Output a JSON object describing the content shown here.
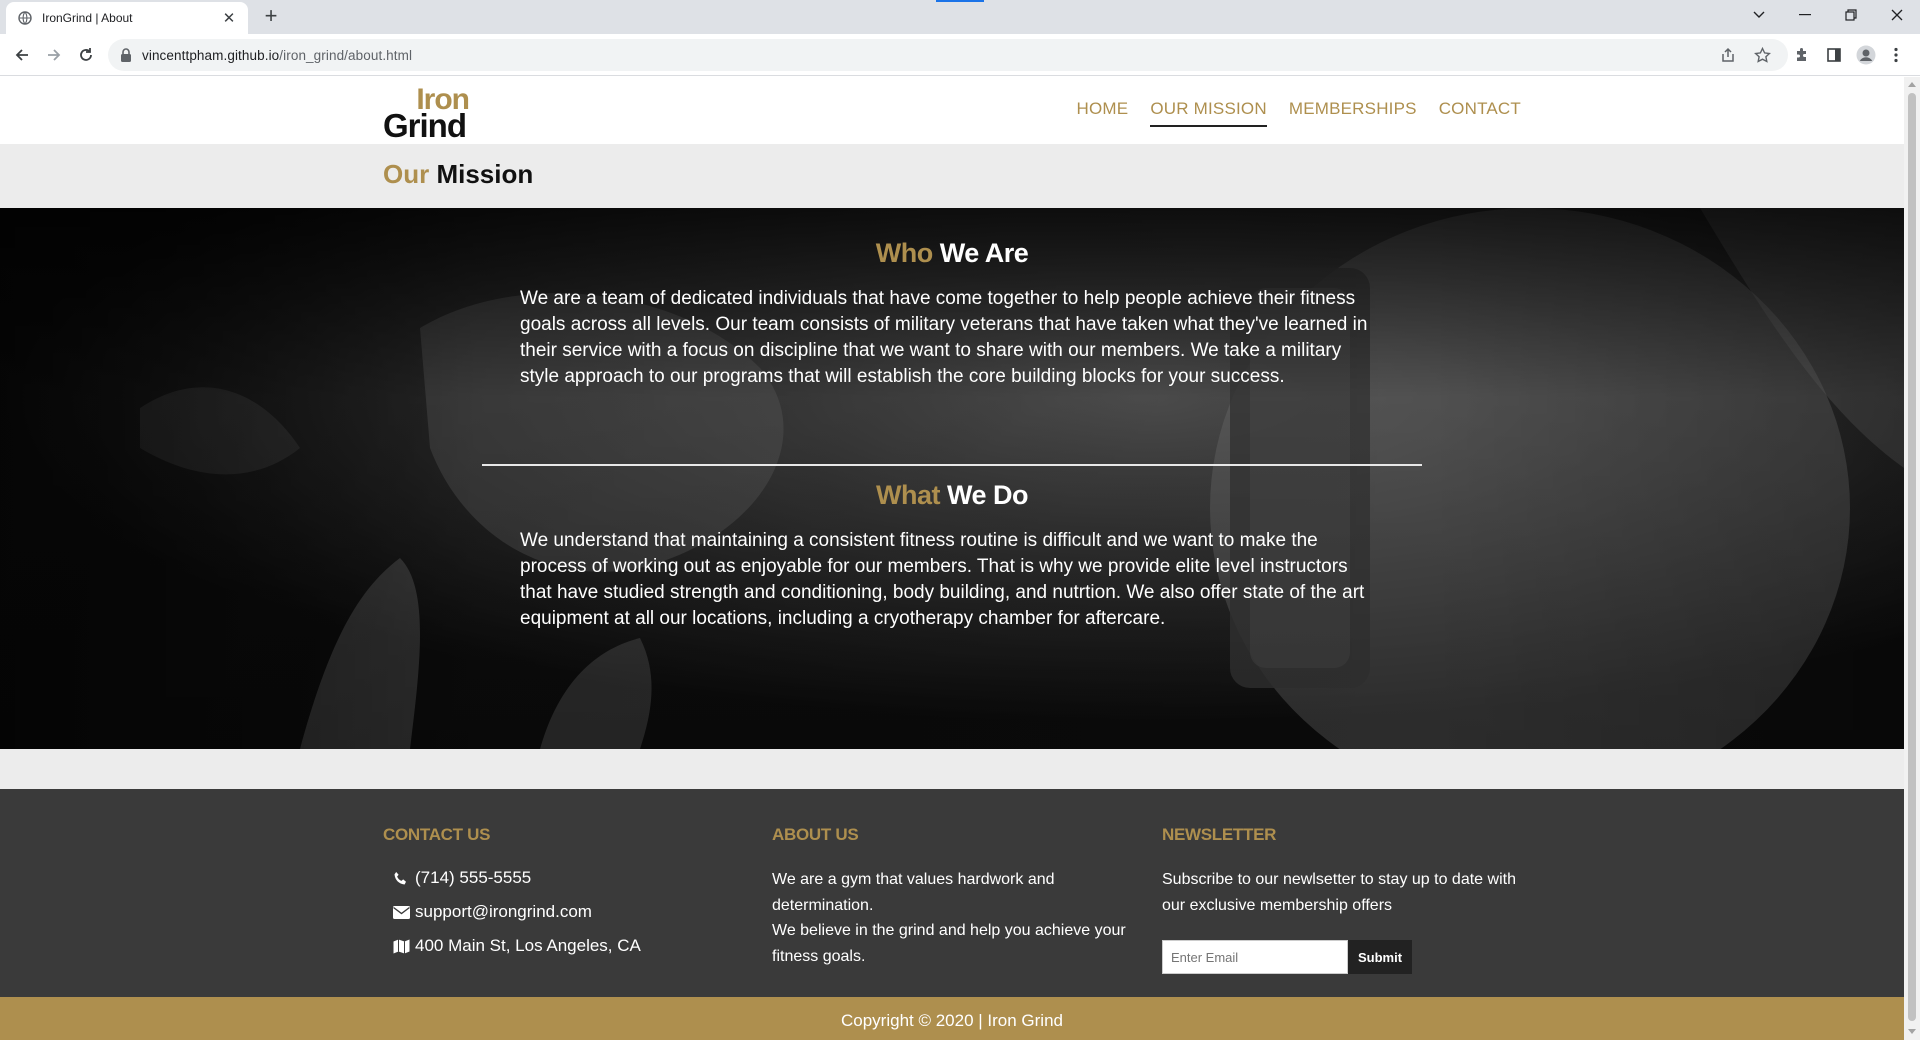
{
  "browser": {
    "tab_title": "IronGrind | About",
    "url_host": "vincenttpham.github.io",
    "url_path": "/iron_grind/about.html"
  },
  "site": {
    "logo_line1": "Iron",
    "logo_line2": "Grind",
    "nav": [
      "HOME",
      "OUR MISSION",
      "MEMBERSHIPS",
      "CONTACT"
    ],
    "active_nav": "OUR MISSION",
    "page_title_accent": "Our",
    "page_title_main": "Mission"
  },
  "sections": {
    "who": {
      "title_accent": "Who",
      "title_main": "We Are",
      "text": "We are a team of dedicated individuals that have come together to help people achieve their fitness goals across all levels. Our team consists of military veterans that have taken what they've learned in their service with a focus on discipline that we want to share with our members. We take a military style approach to our programs that will establish the core building blocks for your success."
    },
    "what": {
      "title_accent": "What",
      "title_main": "We Do",
      "text": "We understand that maintaining a consistent fitness routine is difficult and we want to make the process of working out as enjoyable for our members. That is why we provide elite level instructors that have studied strength and conditioning, body building, and nutrtion. We also offer state of the art equipment at all our locations, including a cryotherapy chamber for aftercare."
    }
  },
  "footer": {
    "contact": {
      "heading": "CONTACT US",
      "phone": "(714) 555-5555",
      "email": "support@irongrind.com",
      "address": "400 Main St, Los Angeles, CA"
    },
    "about": {
      "heading": "ABOUT US",
      "line1": "We are a gym that values hardwork and determination.",
      "line2": "We believe in the grind and help you achieve your fitness goals."
    },
    "newsletter": {
      "heading": "NEWSLETTER",
      "text": "Subscribe to our newlsetter to stay up to date with our exclusive membership offers",
      "placeholder": "Enter Email",
      "submit": "Submit"
    },
    "copyright": "Copyright © 2020 | Iron Grind"
  },
  "colors": {
    "brand_gold": "#ae8f4e",
    "footer_bg": "#3a3a3a",
    "title_bar_bg": "#ececec"
  },
  "icons": [
    "globe-icon",
    "close-icon",
    "plus-icon",
    "back-icon",
    "forward-icon",
    "reload-icon",
    "lock-icon",
    "share-icon",
    "star-icon",
    "extensions-icon",
    "side-panel-icon",
    "profile-icon",
    "kebab-menu-icon",
    "phone-icon",
    "envelope-icon",
    "map-icon"
  ]
}
